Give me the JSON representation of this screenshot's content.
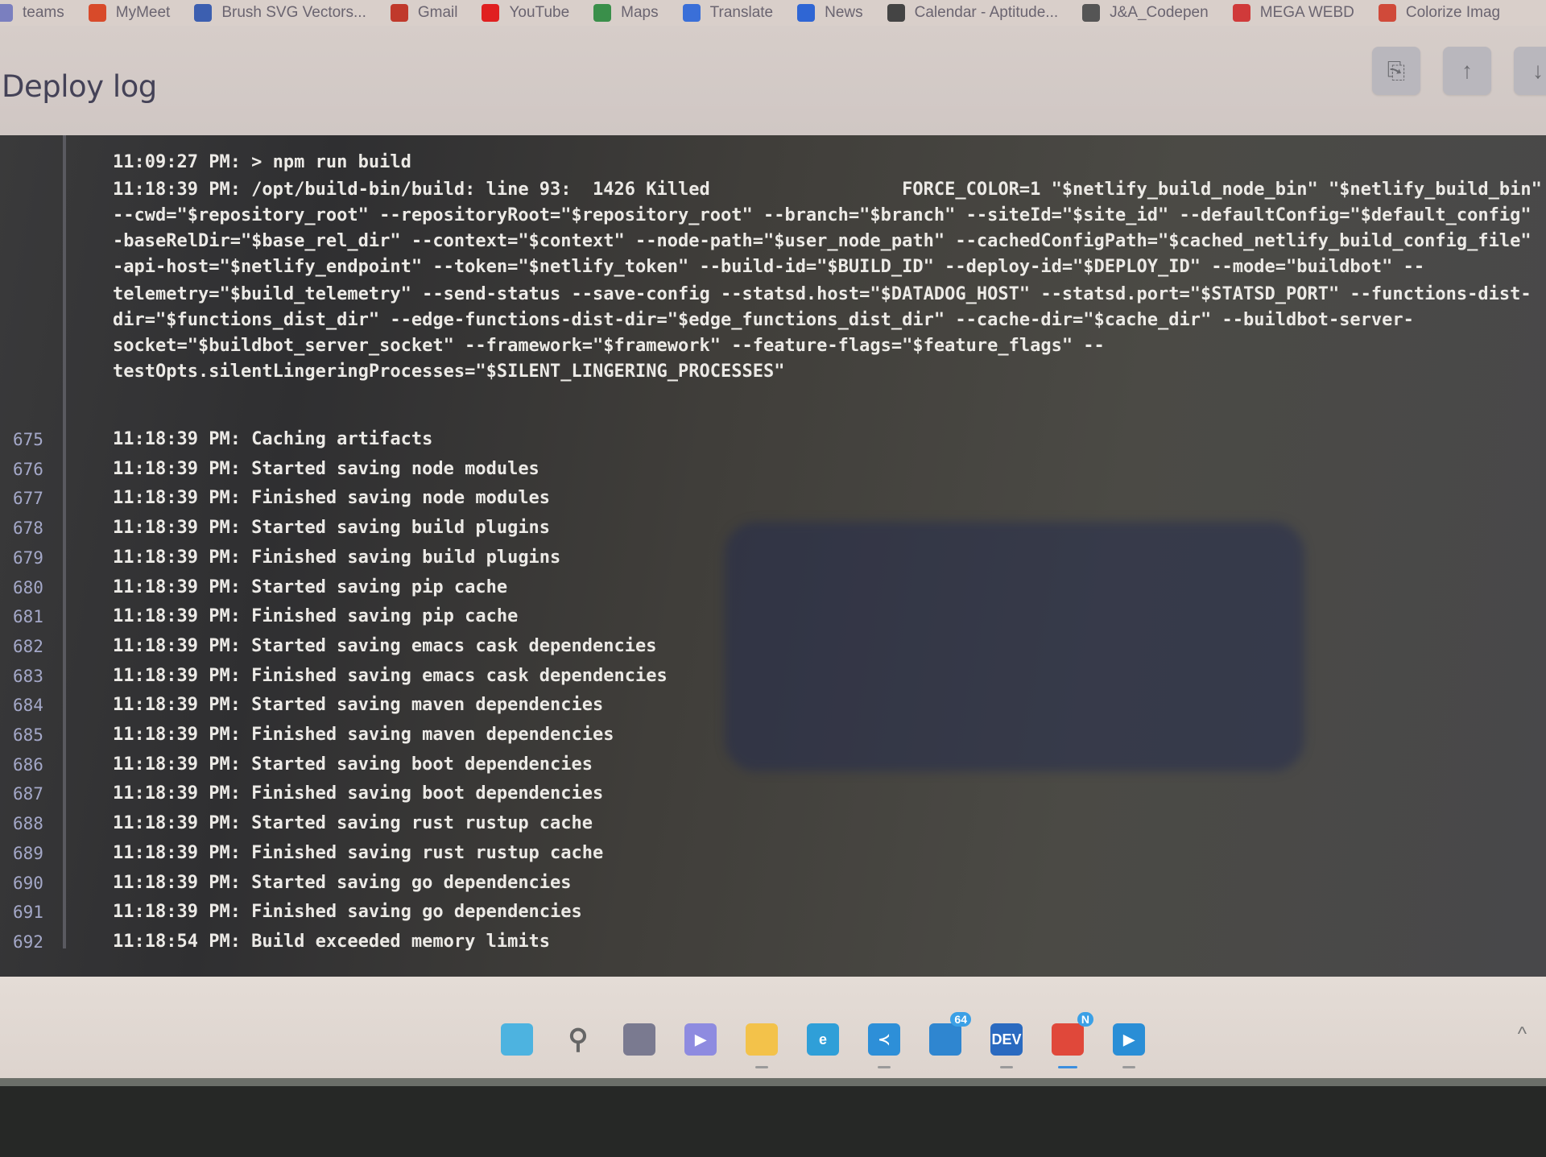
{
  "bookmarks": [
    {
      "label": "teams",
      "icon": "teams-icon",
      "color": "#7a7fbf"
    },
    {
      "label": "MyMeet",
      "icon": "mymeet-icon",
      "color": "#d84a2a"
    },
    {
      "label": "Brush SVG Vectors...",
      "icon": "brush-svg-icon",
      "color": "#3c5fb0"
    },
    {
      "label": "Gmail",
      "icon": "gmail-icon",
      "color": "#c0392b"
    },
    {
      "label": "YouTube",
      "icon": "youtube-icon",
      "color": "#e02020"
    },
    {
      "label": "Maps",
      "icon": "maps-icon",
      "color": "#3a8f4a"
    },
    {
      "label": "Translate",
      "icon": "translate-icon",
      "color": "#3a6fd8"
    },
    {
      "label": "News",
      "icon": "news-icon",
      "color": "#2f66d4"
    },
    {
      "label": "Calendar - Aptitude...",
      "icon": "calendar-icon",
      "color": "#444"
    },
    {
      "label": "J&A_Codepen",
      "icon": "codepen-icon",
      "color": "#555"
    },
    {
      "label": "MEGA WEBD",
      "icon": "mega-icon",
      "color": "#d03a3a"
    },
    {
      "label": "Colorize Imag",
      "icon": "colorize-icon",
      "color": "#d04a3a"
    }
  ],
  "header": {
    "title": "Deploy log",
    "buttons": [
      {
        "name": "copy-log-button",
        "icon": "clipboard-copy-icon",
        "glyph": "⎘"
      },
      {
        "name": "scroll-top-button",
        "icon": "arrow-up-icon",
        "glyph": "↑"
      },
      {
        "name": "scroll-bottom-button",
        "icon": "arrow-down-icon",
        "glyph": "↓"
      }
    ]
  },
  "log": {
    "unnumbered": [
      "11:09:27 PM: > npm run build",
      "11:18:39 PM: /opt/build-bin/build: line 93:  1426 Killed                  FORCE_COLOR=1 \"$netlify_build_node_bin\" \"$netlify_build_bin\"",
      "--cwd=\"$repository_root\" --repositoryRoot=\"$repository_root\" --branch=\"$branch\" --siteId=\"$site_id\" --defaultConfig=\"$default_config\"",
      "-baseRelDir=\"$base_rel_dir\" --context=\"$context\" --node-path=\"$user_node_path\" --cachedConfigPath=\"$cached_netlify_build_config_file\"",
      "-api-host=\"$netlify_endpoint\" --token=\"$netlify_token\" --build-id=\"$BUILD_ID\" --deploy-id=\"$DEPLOY_ID\" --mode=\"buildbot\" --",
      "telemetry=\"$build_telemetry\" --send-status --save-config --statsd.host=\"$DATADOG_HOST\" --statsd.port=\"$STATSD_PORT\" --functions-dist-",
      "dir=\"$functions_dist_dir\" --edge-functions-dist-dir=\"$edge_functions_dist_dir\" --cache-dir=\"$cache_dir\" --buildbot-server-",
      "socket=\"$buildbot_server_socket\" --framework=\"$framework\" --feature-flags=\"$feature_flags\" --",
      "testOpts.silentLingeringProcesses=\"$SILENT_LINGERING_PROCESSES\""
    ],
    "lines": [
      {
        "n": "675",
        "text": "11:18:39 PM: Caching artifacts"
      },
      {
        "n": "676",
        "text": "11:18:39 PM: Started saving node modules"
      },
      {
        "n": "677",
        "text": "11:18:39 PM: Finished saving node modules"
      },
      {
        "n": "678",
        "text": "11:18:39 PM: Started saving build plugins"
      },
      {
        "n": "679",
        "text": "11:18:39 PM: Finished saving build plugins"
      },
      {
        "n": "680",
        "text": "11:18:39 PM: Started saving pip cache"
      },
      {
        "n": "681",
        "text": "11:18:39 PM: Finished saving pip cache"
      },
      {
        "n": "682",
        "text": "11:18:39 PM: Started saving emacs cask dependencies"
      },
      {
        "n": "683",
        "text": "11:18:39 PM: Finished saving emacs cask dependencies"
      },
      {
        "n": "684",
        "text": "11:18:39 PM: Started saving maven dependencies"
      },
      {
        "n": "685",
        "text": "11:18:39 PM: Finished saving maven dependencies"
      },
      {
        "n": "686",
        "text": "11:18:39 PM: Started saving boot dependencies"
      },
      {
        "n": "687",
        "text": "11:18:39 PM: Finished saving boot dependencies"
      },
      {
        "n": "688",
        "text": "11:18:39 PM: Started saving rust rustup cache"
      },
      {
        "n": "689",
        "text": "11:18:39 PM: Finished saving rust rustup cache"
      },
      {
        "n": "690",
        "text": "11:18:39 PM: Started saving go dependencies"
      },
      {
        "n": "691",
        "text": "11:18:39 PM: Finished saving go dependencies"
      },
      {
        "n": "692",
        "text": "11:18:54 PM: Build exceeded memory limits"
      }
    ]
  },
  "taskbar": {
    "items": [
      {
        "name": "start-button",
        "icon": "windows-start-icon",
        "glyph": "",
        "bg": "#4db3e0",
        "running": false
      },
      {
        "name": "search-button",
        "icon": "search-icon",
        "glyph": "⚲",
        "bg": "transparent",
        "running": false
      },
      {
        "name": "task-view-button",
        "icon": "task-view-icon",
        "glyph": "",
        "bg": "#7a7a90",
        "running": false
      },
      {
        "name": "chat-button",
        "icon": "chat-video-icon",
        "glyph": "▶",
        "bg": "#8e8be0",
        "running": false
      },
      {
        "name": "file-explorer-button",
        "icon": "folder-icon",
        "glyph": "",
        "bg": "#f3c24a",
        "running": true
      },
      {
        "name": "edge-button",
        "icon": "edge-browser-icon",
        "glyph": "e",
        "bg": "#2f9fd8",
        "running": false
      },
      {
        "name": "vscode-button",
        "icon": "vscode-icon",
        "glyph": "≺",
        "bg": "#2d8fd8",
        "running": true
      },
      {
        "name": "remote-desktop-button",
        "icon": "monitor-icon",
        "glyph": "",
        "bg": "#2f86d0",
        "running": false,
        "badge": "64"
      },
      {
        "name": "devsql-button",
        "icon": "dev-sql-icon",
        "glyph": "DEV",
        "bg": "#2a6ac0",
        "running": true
      },
      {
        "name": "chrome-button",
        "icon": "chrome-icon",
        "glyph": "",
        "bg": "#e0483a",
        "running": true,
        "active": true,
        "badge": "N"
      },
      {
        "name": "media-player-button",
        "icon": "media-player-icon",
        "glyph": "▶",
        "bg": "#2a8ed6",
        "running": true
      }
    ],
    "tray_chevron": "^"
  }
}
